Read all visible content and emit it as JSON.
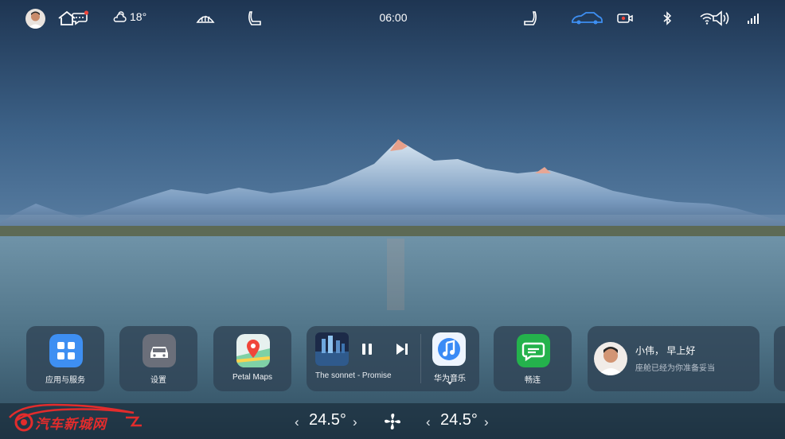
{
  "status_bar": {
    "temperature": "18°",
    "time": "06:00"
  },
  "apps": [
    {
      "label": "应用与服务",
      "icon": "apps-grid-icon"
    },
    {
      "label": "设置",
      "icon": "car-settings-icon"
    },
    {
      "label": "Petal Maps",
      "icon": "petal-maps-icon"
    }
  ],
  "music": {
    "song": "The sonnet - Promise",
    "app_label": "华为音乐"
  },
  "messaging": {
    "label": "畅连",
    "icon": "changlian-icon"
  },
  "greeting": {
    "title": "小伟， 早上好",
    "subtitle": "座舱已经为你准备妥当"
  },
  "dock": {
    "left_temp": "24.5°",
    "right_temp": "24.5°",
    "chev_left": "‹",
    "chev_right": "›"
  },
  "watermark": {
    "text": "汽车新城网"
  },
  "colors": {
    "card_bg": "#304254",
    "accent_blue": "#3e8ff2",
    "watermark_red": "#e32c2c"
  }
}
